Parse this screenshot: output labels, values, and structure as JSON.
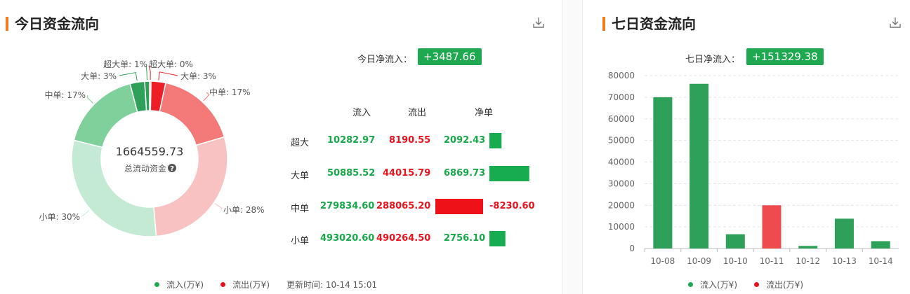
{
  "today": {
    "title": "今日资金流向",
    "net_label": "今日净流入：",
    "net_value": "+3487.66",
    "total_value": "1664559.73",
    "total_label": "总流动资金",
    "donut_labels": {
      "in_super": "超大单: 1%",
      "in_big": "大单: 3%",
      "in_mid": "中单: 17%",
      "in_small": "小单: 30%",
      "out_super": "超大单: 0%",
      "out_big": "大单: 3%",
      "out_mid": "中单: 17%",
      "out_small": "小单: 28%"
    },
    "table": {
      "headers": [
        "流入",
        "流出",
        "净单"
      ],
      "rows": [
        {
          "label": "超大",
          "inflow": "10282.97",
          "outflow": "8190.55",
          "net": "2092.43"
        },
        {
          "label": "大单",
          "inflow": "50885.52",
          "outflow": "44015.79",
          "net": "6869.73"
        },
        {
          "label": "中单",
          "inflow": "279834.60",
          "outflow": "288065.20",
          "net": "-8230.60"
        },
        {
          "label": "小单",
          "inflow": "493020.60",
          "outflow": "490264.50",
          "net": "2756.10"
        }
      ]
    },
    "legend": {
      "inflow": "流入(万¥)",
      "outflow": "流出(万¥)",
      "update": "更新时间: 10-14 15:01"
    }
  },
  "seven_day": {
    "title": "七日资金流向",
    "net_label": "七日净流入：",
    "net_value": "+151329.38",
    "legend": {
      "inflow": "流入(万¥)",
      "outflow": "流出(万¥)"
    }
  },
  "colors": {
    "in_dark": "#2ea05a",
    "in_mid": "#7fd09b",
    "in_light": "#c5ead3",
    "out_dark": "#ee1e26",
    "out_mid": "#f47a7a",
    "out_light": "#f9c2c2",
    "accent": "#f07c1e",
    "badge": "#1ea84f"
  },
  "chart_data": [
    {
      "type": "pie",
      "title": "",
      "center_label": "总流动资金",
      "center_value": 1664559.73,
      "series": [
        {
          "name": "流入(万¥)",
          "labels": [
            "超大单",
            "大单",
            "中单",
            "小单"
          ],
          "values": [
            1,
            3,
            17,
            30
          ]
        },
        {
          "name": "流出(万¥)",
          "labels": [
            "超大单",
            "大单",
            "中单",
            "小单"
          ],
          "values": [
            0,
            3,
            17,
            28
          ]
        }
      ]
    },
    {
      "type": "bar",
      "title": "",
      "categories": [
        "超大",
        "大单",
        "中单",
        "小单"
      ],
      "values": [
        2092.43,
        6869.73,
        -8230.6,
        2756.1
      ]
    },
    {
      "type": "bar",
      "title": "",
      "categories": [
        "10-08",
        "10-09",
        "10-10",
        "10-11",
        "10-12",
        "10-13",
        "10-14"
      ],
      "values": [
        70000,
        76200,
        6600,
        20000,
        1200,
        13800,
        3400
      ],
      "direction": [
        "inflow",
        "inflow",
        "inflow",
        "outflow",
        "inflow",
        "inflow",
        "inflow"
      ],
      "ylim": [
        0,
        80000
      ],
      "yticks": [
        0,
        10000,
        20000,
        30000,
        40000,
        50000,
        60000,
        70000,
        80000
      ],
      "grid": true,
      "legend": "bottom"
    }
  ]
}
